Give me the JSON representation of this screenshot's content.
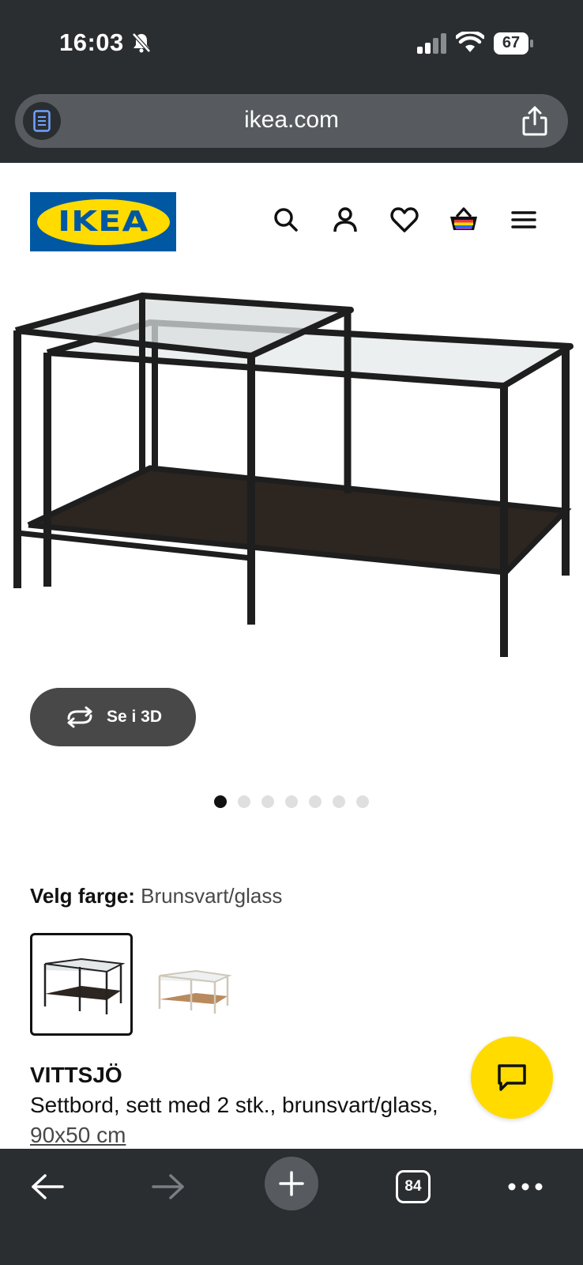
{
  "status": {
    "time": "16:03",
    "battery": "67"
  },
  "browser": {
    "url": "ikea.com",
    "tab_count": "84"
  },
  "brand": {
    "logo_text": "IKEA",
    "blue": "#0058a3",
    "yellow": "#ffdb00"
  },
  "header": {
    "icons": [
      "search-icon",
      "account-icon",
      "heart-icon",
      "basket-icon",
      "menu-icon"
    ]
  },
  "gallery": {
    "view_3d_label": "Se i 3D",
    "image_count": 7,
    "active_index": 0
  },
  "color": {
    "label": "Velg farge:",
    "value": "Brunsvart/glass"
  },
  "product": {
    "name": "VITTSJÖ",
    "description": "Settbord, sett med 2 stk., brunsvart/glass,",
    "size": "90x50 cm"
  }
}
